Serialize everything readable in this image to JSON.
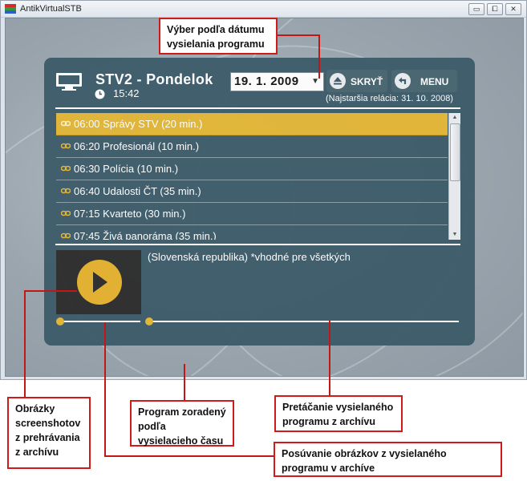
{
  "window": {
    "title": "AntikVirtualSTB",
    "controls": [
      "minimize",
      "maximize",
      "close"
    ],
    "control_glyphs": {
      "minimize": "▭",
      "maximize": "⧠",
      "close": "✕"
    }
  },
  "header": {
    "channel_title": "STV2 - Pondelok",
    "time": "15:42",
    "date_value": "19.   1. 2009",
    "hide_button": "SKRYŤ",
    "menu_button": "MENU",
    "oldest_note": "(Najstaršia relácia: 31. 10. 2008)"
  },
  "programs": [
    {
      "label": "06:00 Správy STV (20 min.)",
      "selected": true
    },
    {
      "label": "06:20 Profesionál (10 min.)",
      "selected": false
    },
    {
      "label": "06:30 Polícia (10 min.)",
      "selected": false
    },
    {
      "label": "06:40 Udalosti ČT (35 min.)",
      "selected": false
    },
    {
      "label": "07:15 Kvarteto (30 min.)",
      "selected": false
    },
    {
      "label": "07:45 Živá panoráma (35 min.)",
      "selected": false
    }
  ],
  "description": "(Slovenská republika) *vhodné pre všetkých",
  "callouts": {
    "date_selection": "Výber podľa dátumu vysielania programu",
    "screenshots": "Obrázky screenshotov z prehrávania z archívu",
    "program_sorted": "Program zoradený podľa vysielacieho času",
    "seek": "Pretáčanie vysielaného programu  z archívu",
    "scroll_images": "Posúvanie obrázkov z vysielaného programu v archíve"
  },
  "colors": {
    "panel": "#3e5c6b",
    "highlight": "#e3b636",
    "callout_border": "#d11a1a"
  },
  "icons": [
    "tv-icon",
    "clock-icon",
    "eject-icon",
    "back-icon",
    "play-icon",
    "record-link-icon"
  ]
}
